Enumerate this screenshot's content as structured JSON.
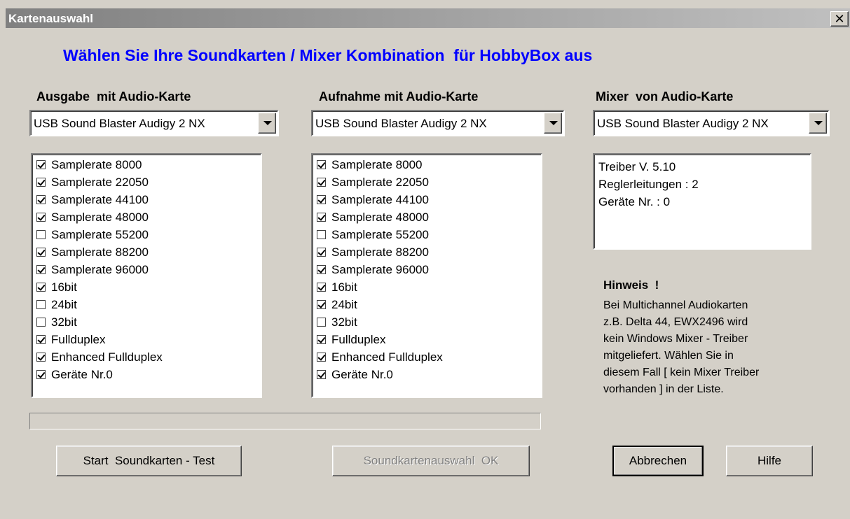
{
  "window": {
    "title": "Kartenauswahl",
    "close_glyph": "✕"
  },
  "heading": "Wählen Sie Ihre Soundkarten / Mixer Kombination  für HobbyBox aus",
  "columns": {
    "output": {
      "label": "Ausgabe  mit Audio-Karte",
      "device": "USB Sound Blaster Audigy 2 NX"
    },
    "record": {
      "label": "Aufnahme mit Audio-Karte",
      "device": "USB Sound Blaster Audigy 2 NX"
    },
    "mixer": {
      "label": "Mixer  von Audio-Karte",
      "device": "USB Sound Blaster Audigy 2 NX"
    }
  },
  "output_caps": [
    {
      "label": "Samplerate 8000",
      "checked": true
    },
    {
      "label": "Samplerate 22050",
      "checked": true
    },
    {
      "label": "Samplerate 44100",
      "checked": true
    },
    {
      "label": "Samplerate 48000",
      "checked": true
    },
    {
      "label": "Samplerate 55200",
      "checked": false
    },
    {
      "label": "Samplerate 88200",
      "checked": true
    },
    {
      "label": "Samplerate 96000",
      "checked": true
    },
    {
      "label": "16bit",
      "checked": true
    },
    {
      "label": "24bit",
      "checked": false
    },
    {
      "label": "32bit",
      "checked": false
    },
    {
      "label": "Fullduplex",
      "checked": true
    },
    {
      "label": "Enhanced Fullduplex",
      "checked": true
    },
    {
      "label": "Geräte Nr.0",
      "checked": true
    }
  ],
  "record_caps": [
    {
      "label": "Samplerate 8000",
      "checked": true
    },
    {
      "label": "Samplerate 22050",
      "checked": true
    },
    {
      "label": "Samplerate 44100",
      "checked": true
    },
    {
      "label": "Samplerate 48000",
      "checked": true
    },
    {
      "label": "Samplerate 55200",
      "checked": false
    },
    {
      "label": "Samplerate 88200",
      "checked": true
    },
    {
      "label": "Samplerate 96000",
      "checked": true
    },
    {
      "label": "16bit",
      "checked": true
    },
    {
      "label": "24bit",
      "checked": true
    },
    {
      "label": "32bit",
      "checked": false
    },
    {
      "label": "Fullduplex",
      "checked": true
    },
    {
      "label": "Enhanced Fullduplex",
      "checked": true
    },
    {
      "label": "Geräte Nr.0",
      "checked": true
    }
  ],
  "mixer_info": [
    "Treiber V. 5.10",
    "Reglerleitungen : 2",
    "Geräte Nr. : 0"
  ],
  "hint": {
    "title": "Hinweis  !",
    "lines": [
      "Bei Multichannel Audiokarten",
      "z.B. Delta 44, EWX2496 wird",
      "kein Windows Mixer - Treiber",
      "mitgeliefert.  Wählen Sie in",
      "diesem Fall  [ kein Mixer Treiber",
      "vorhanden ]  in der Liste."
    ]
  },
  "progress": {
    "value": 0
  },
  "buttons": {
    "start_test": "Start  Soundkarten - Test",
    "ok": "Soundkartenauswahl  OK",
    "cancel": "Abbrechen",
    "help": "Hilfe"
  },
  "colors": {
    "dialog_bg": "#d4d0c8",
    "heading": "#0000ff",
    "title_text": "#ffffff"
  }
}
